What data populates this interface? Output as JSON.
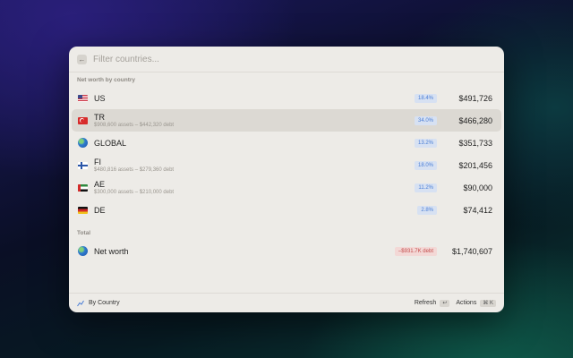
{
  "search": {
    "placeholder": "Filter countries..."
  },
  "sections": {
    "countries_title": "Net worth by country",
    "total_title": "Total"
  },
  "rows": [
    {
      "code": "US",
      "sub": "",
      "badge": "18.4%",
      "amount": "$491,726",
      "flag": "us-flag-icon"
    },
    {
      "code": "TR",
      "sub": "$908,600 assets – $442,320 debt",
      "badge": "34.0%",
      "amount": "$466,280",
      "flag": "tr-flag-icon"
    },
    {
      "code": "GLOBAL",
      "sub": "",
      "badge": "13.2%",
      "amount": "$351,733",
      "flag": "globe-icon"
    },
    {
      "code": "FI",
      "sub": "$480,816 assets – $279,360 debt",
      "badge": "18.0%",
      "amount": "$201,456",
      "flag": "fi-flag-icon"
    },
    {
      "code": "AE",
      "sub": "$300,000 assets – $210,000 debt",
      "badge": "11.2%",
      "amount": "$90,000",
      "flag": "ae-flag-icon"
    },
    {
      "code": "DE",
      "sub": "",
      "badge": "2.8%",
      "amount": "$74,412",
      "flag": "de-flag-icon"
    }
  ],
  "total": {
    "label": "Net worth",
    "badge": "–$931.7K debt",
    "amount": "$1,740,607"
  },
  "footer": {
    "view_label": "By Country",
    "refresh_label": "Refresh",
    "refresh_key": "↩",
    "actions_label": "Actions",
    "actions_key": "⌘ K"
  },
  "colors": {
    "accent_badge": "#4a7ed6",
    "debt_badge": "#c44a4a",
    "selected_row": "#dcd9d3"
  }
}
